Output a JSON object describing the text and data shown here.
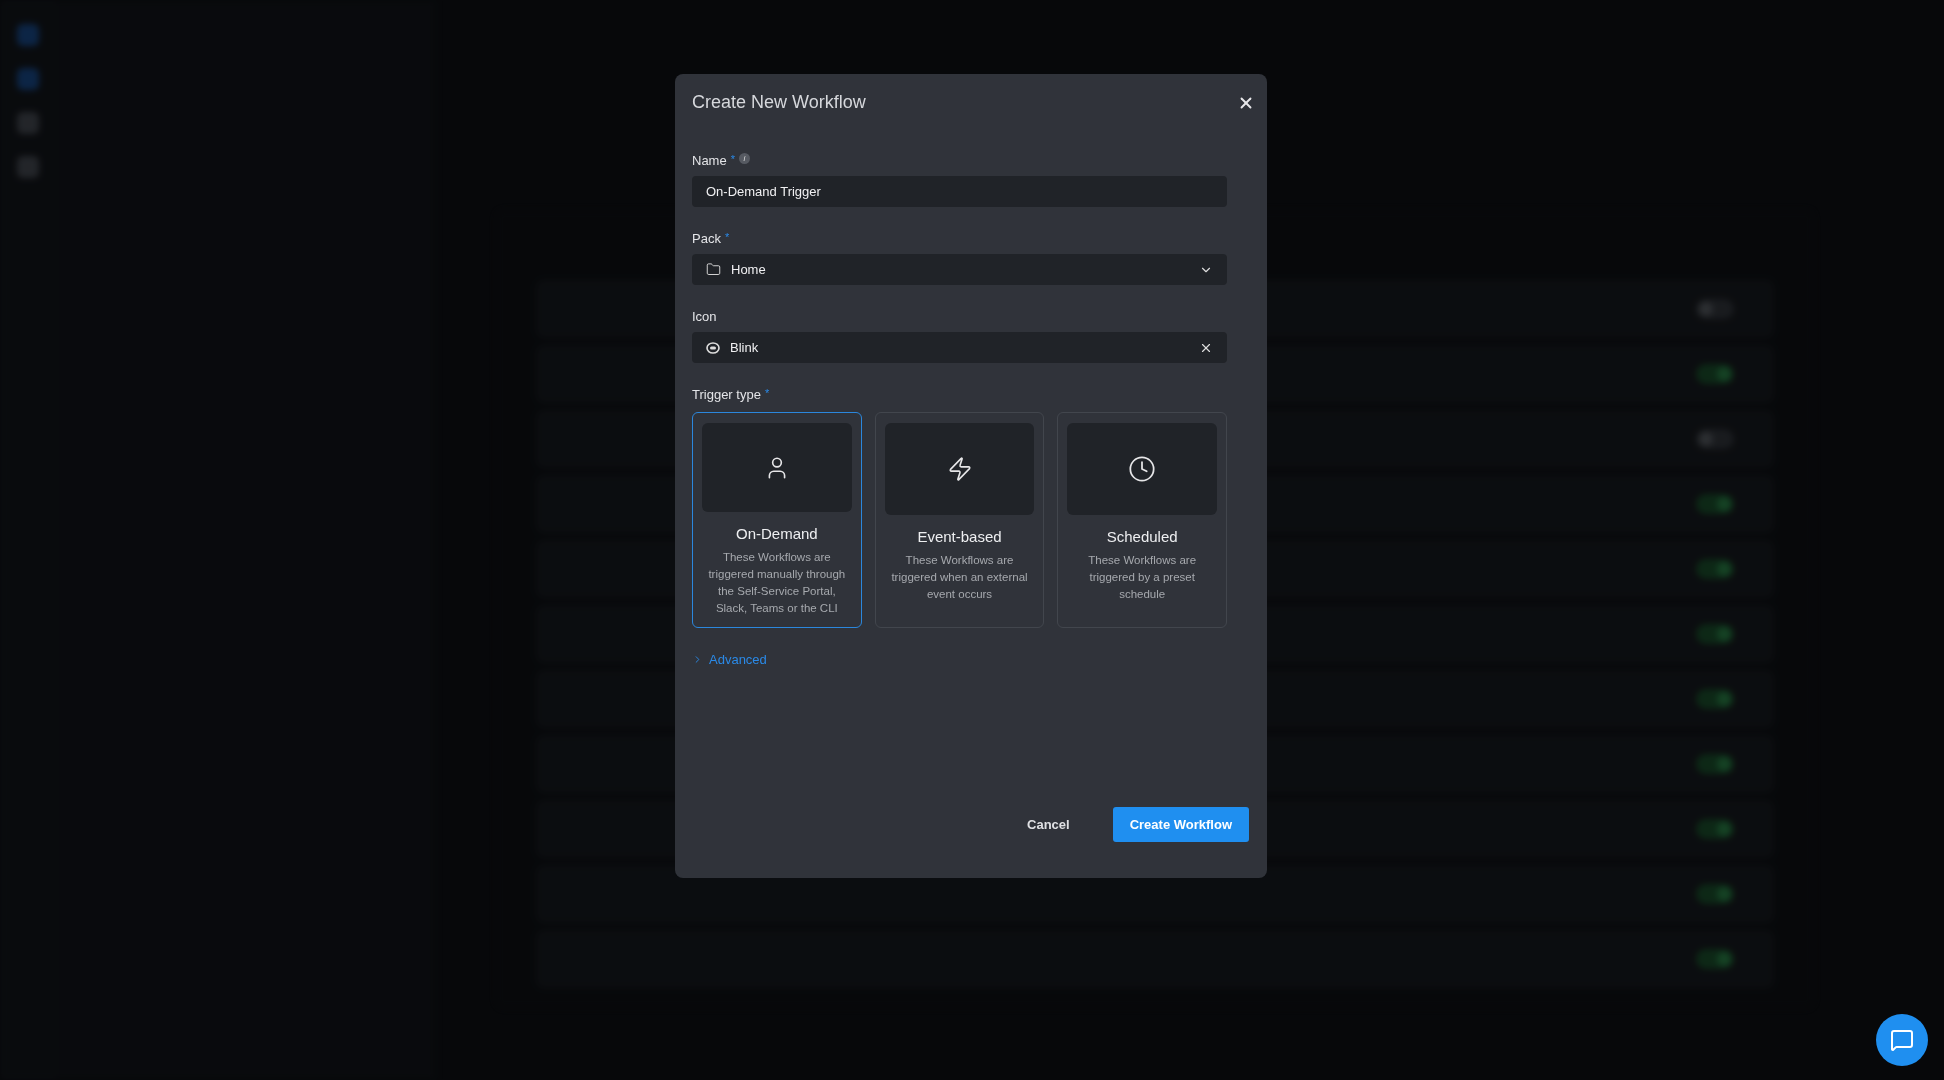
{
  "background": {
    "rows": [
      {
        "on": false
      },
      {
        "on": true
      },
      {
        "on": false
      },
      {
        "on": true
      },
      {
        "on": true
      },
      {
        "on": true
      },
      {
        "on": true
      },
      {
        "on": true
      },
      {
        "on": true
      },
      {
        "on": true
      },
      {
        "on": true
      }
    ]
  },
  "dialog": {
    "title": "Create New Workflow",
    "fields": [
      {
        "kind": "text",
        "label": "Name",
        "required_mark": "*",
        "info": "i",
        "value": "On-Demand Trigger"
      },
      {
        "kind": "select",
        "label": "Pack",
        "required_mark": "*",
        "value": "Home"
      },
      {
        "kind": "icon",
        "label": "Icon",
        "value": "Blink"
      }
    ],
    "trigger_type": {
      "label": "Trigger type",
      "required_mark": "*",
      "options": [
        {
          "kind": "person",
          "title": "On-Demand",
          "description": "These Workflows are triggered manually through the Self-Service Portal, Slack, Teams or the CLI",
          "selected": true
        },
        {
          "kind": "bolt",
          "title": "Event-based",
          "description": "These Workflows are triggered when an external event occurs",
          "selected": false
        },
        {
          "kind": "clock",
          "title": "Scheduled",
          "description": "These Workflows are triggered by a preset schedule",
          "selected": false
        }
      ]
    },
    "advanced": {
      "label": "Advanced",
      "expanded": false
    },
    "buttons": [
      {
        "kind": "secondary",
        "label": "Cancel"
      },
      {
        "kind": "primary",
        "label": "Create Workflow"
      }
    ]
  }
}
